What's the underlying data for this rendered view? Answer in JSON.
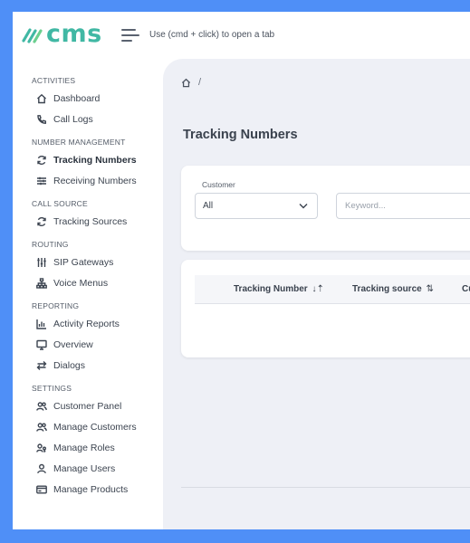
{
  "app": {
    "logo_text": "cms",
    "hint": "Use (cmd + click) to open a tab",
    "accent_color": "#41b8a4",
    "background_color": "#4f8ff7"
  },
  "sidebar": {
    "sections": [
      {
        "title": "ACTIVITIES",
        "items": [
          {
            "label": "Dashboard",
            "icon": "home-icon"
          },
          {
            "label": "Call Logs",
            "icon": "phone-icon"
          }
        ]
      },
      {
        "title": "NUMBER MANAGEMENT",
        "items": [
          {
            "label": "Tracking Numbers",
            "icon": "refresh-icon",
            "active": true
          },
          {
            "label": "Receiving Numbers",
            "icon": "sliders-icon"
          }
        ]
      },
      {
        "title": "CALL SOURCE",
        "items": [
          {
            "label": "Tracking Sources",
            "icon": "refresh-icon"
          }
        ]
      },
      {
        "title": "ROUTING",
        "items": [
          {
            "label": "SIP Gateways",
            "icon": "equalizer-icon"
          },
          {
            "label": "Voice Menus",
            "icon": "sitemap-icon"
          }
        ]
      },
      {
        "title": "REPORTING",
        "items": [
          {
            "label": "Activity Reports",
            "icon": "bar-chart-icon"
          },
          {
            "label": "Overview",
            "icon": "monitor-icon"
          },
          {
            "label": "Dialogs",
            "icon": "swap-icon"
          }
        ]
      },
      {
        "title": "SETTINGS",
        "items": [
          {
            "label": "Customer Panel",
            "icon": "users-icon"
          },
          {
            "label": "Manage Customers",
            "icon": "users-icon"
          },
          {
            "label": "Manage Roles",
            "icon": "user-key-icon"
          },
          {
            "label": "Manage Users",
            "icon": "user-icon"
          },
          {
            "label": "Manage Products",
            "icon": "card-icon"
          }
        ]
      }
    ]
  },
  "breadcrumb": {
    "separator": "/"
  },
  "page": {
    "title": "Tracking Numbers"
  },
  "filters": {
    "customer_label": "Customer",
    "customer_value": "All",
    "keyword_placeholder": "Keyword..."
  },
  "table": {
    "columns": [
      {
        "label": "Tracking Number",
        "sort_icon": "↓⇡"
      },
      {
        "label": "Tracking source",
        "sort_icon": "⇅"
      },
      {
        "label": "Cu",
        "sort_icon": ""
      }
    ]
  }
}
